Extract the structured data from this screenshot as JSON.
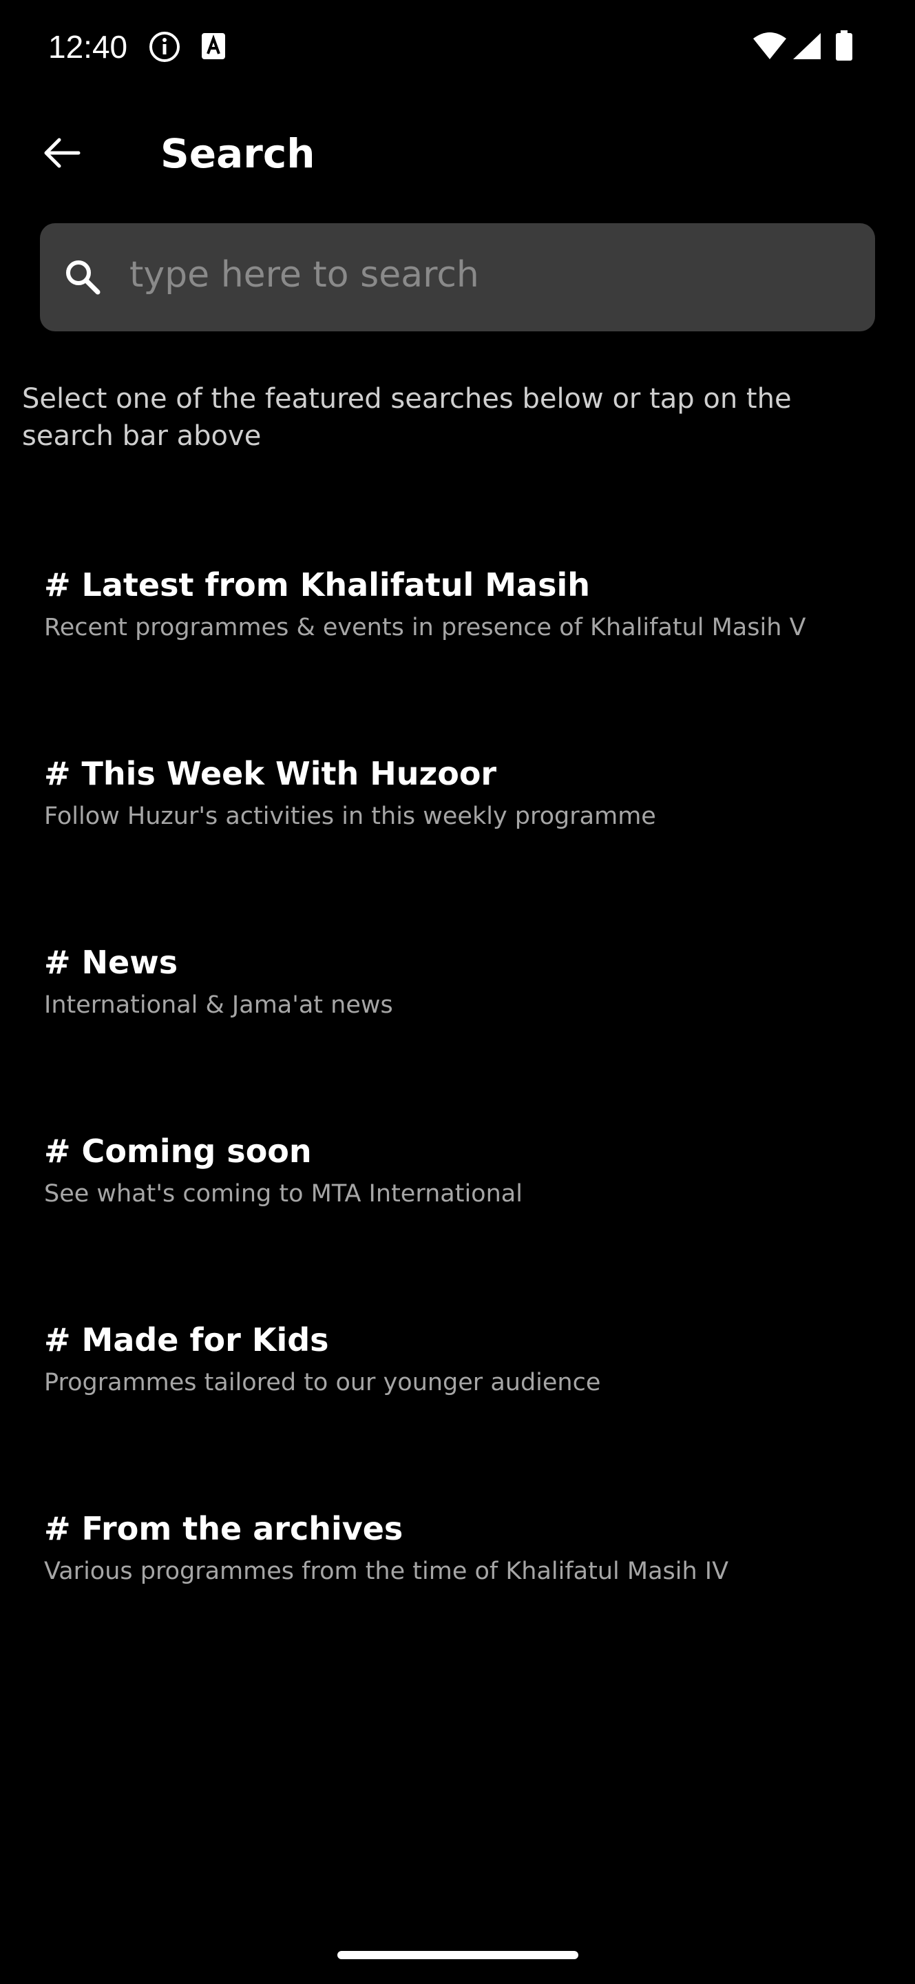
{
  "status_bar": {
    "time": "12:40",
    "icons": [
      "info-icon",
      "a-badge-icon",
      "wifi-icon",
      "signal-icon",
      "battery-icon"
    ]
  },
  "header": {
    "back_icon": "arrow-left-icon",
    "title": "Search"
  },
  "search": {
    "icon": "search-icon",
    "placeholder": "type here to search",
    "value": ""
  },
  "intro": {
    "text": "Select one of the featured searches below or tap on the search bar above"
  },
  "featured": [
    {
      "title": "# Latest from Khalifatul Masih",
      "subtitle": "Recent programmes & events in presence of Khalifatul Masih V"
    },
    {
      "title": "# This Week With Huzoor",
      "subtitle": "Follow Huzur's activities in this weekly programme"
    },
    {
      "title": "# News",
      "subtitle": "International & Jama'at news"
    },
    {
      "title": "# Coming soon",
      "subtitle": "See what's coming to MTA International"
    },
    {
      "title": "# Made for Kids",
      "subtitle": "Programmes tailored to our younger audience"
    },
    {
      "title": "# From the archives",
      "subtitle": "Various programmes from the time of Khalifatul Masih IV"
    }
  ],
  "colors": {
    "background": "#000000",
    "search_bar": "#3c3c3c",
    "title_text": "#ffffff",
    "subtitle_text": "#a6a6a6",
    "placeholder": "#8a8a8a"
  }
}
